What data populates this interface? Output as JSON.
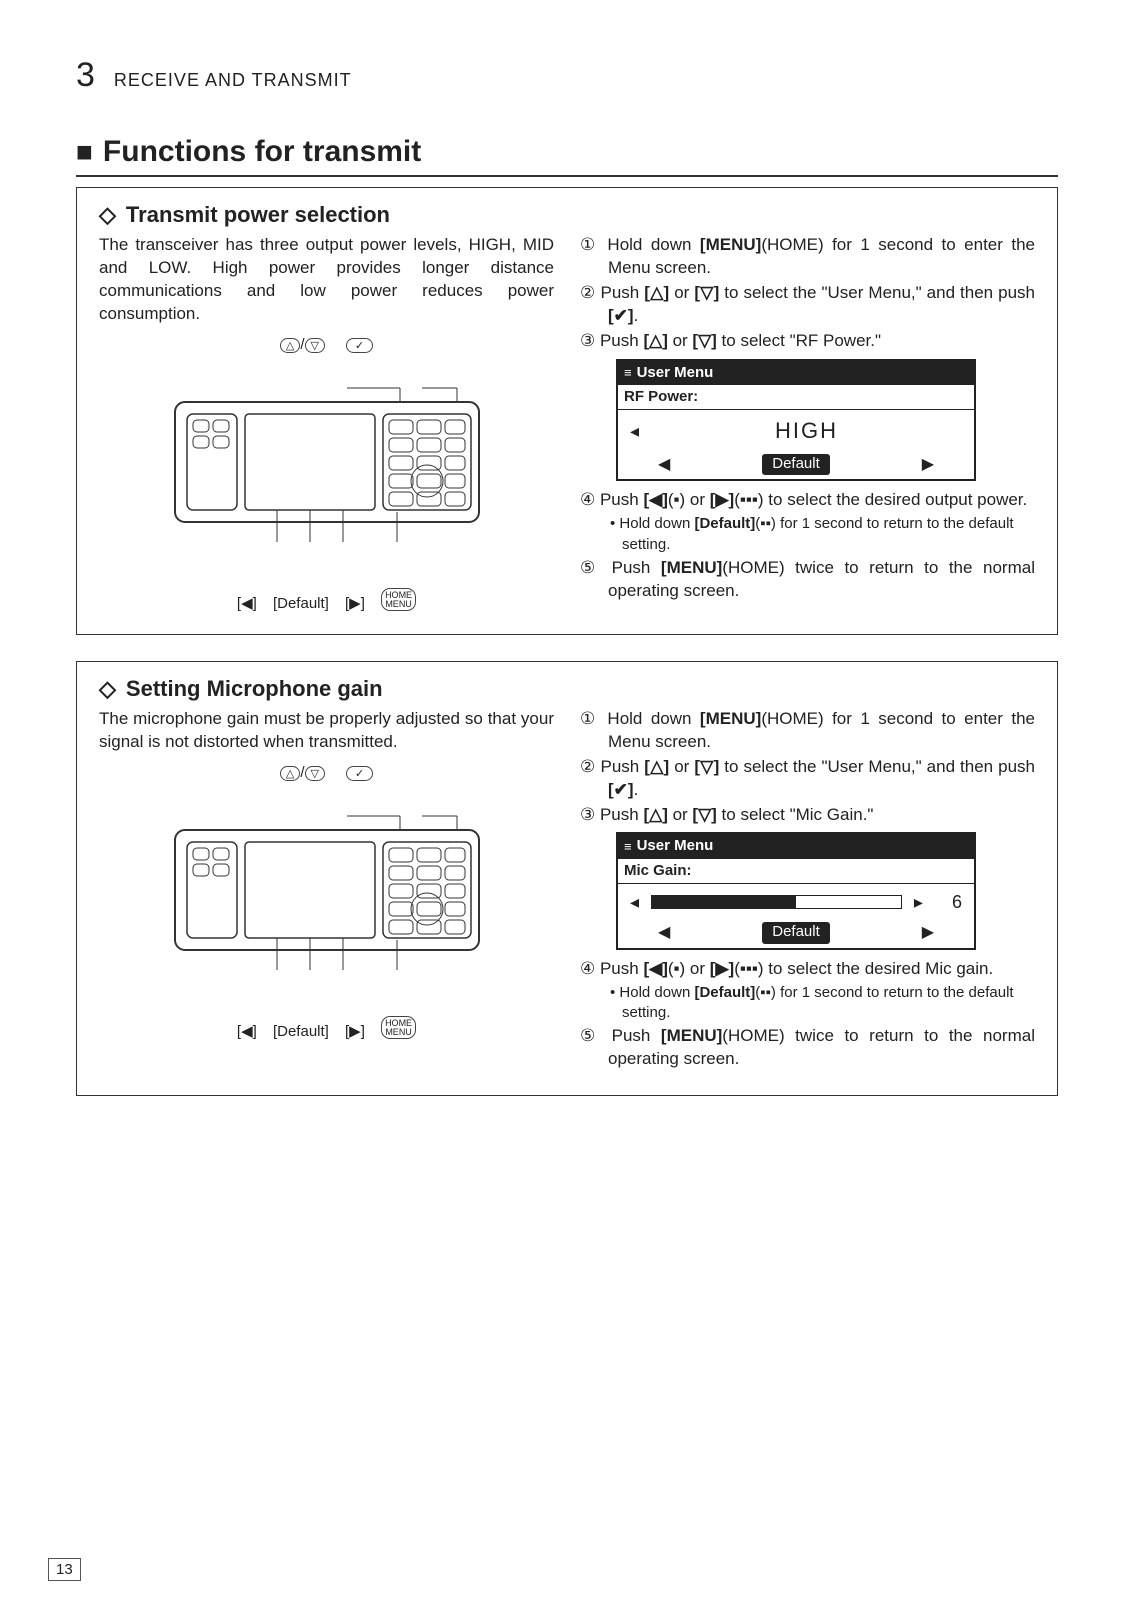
{
  "header": {
    "chapter_num": "3",
    "chapter_title": "RECEIVE AND TRANSMIT"
  },
  "main_title": "Functions for transmit",
  "section1": {
    "title": "Transmit power selection",
    "intro": "The transceiver has three output power levels, HIGH, MID and LOW. High power provides longer distance communications and low power reduces power consumption.",
    "top_callout_updn": "/",
    "bottom_callouts": {
      "left": "[◀]",
      "default": "[Default]",
      "right": "[▶]"
    },
    "steps": {
      "s1a": "Hold down ",
      "s1b": "[MENU]",
      "s1c": "(HOME) for 1 second to enter the Menu screen.",
      "s2a": "Push ",
      "s2b": "[△]",
      "s2c": " or ",
      "s2d": "[▽]",
      "s2e": " to select the \"User Menu,\" and then push ",
      "s2f": "[✔]",
      "s2g": ".",
      "s3a": "Push ",
      "s3b": "[△]",
      "s3c": " or ",
      "s3d": "[▽]",
      "s3e": " to select \"RF Power.\"",
      "s4a": "Push ",
      "s4b": "[◀]",
      "s4c": "(▪) or ",
      "s4d": "[▶]",
      "s4e": "(▪▪▪) to select the desired output power.",
      "note_a": "• Hold down ",
      "note_b": "[Default]",
      "note_c": "(▪▪) for 1 second to return to the default setting.",
      "s5a": "Push ",
      "s5b": "[MENU]",
      "s5c": "(HOME) twice to return to the normal operating screen."
    },
    "lcd": {
      "header": "User Menu",
      "sub": "RF Power:",
      "value": "HIGH",
      "default": "Default"
    }
  },
  "section2": {
    "title": "Setting Microphone gain",
    "intro": "The microphone gain must be properly adjusted so that your signal is not distorted when transmitted.",
    "bottom_callouts": {
      "left": "[◀]",
      "default": "[Default]",
      "right": "[▶]"
    },
    "steps": {
      "s1a": "Hold down ",
      "s1b": "[MENU]",
      "s1c": "(HOME) for 1 second to enter the Menu screen.",
      "s2a": "Push ",
      "s2b": "[△]",
      "s2c": " or ",
      "s2d": "[▽]",
      "s2e": " to select the \"User Menu,\" and then push ",
      "s2f": "[✔]",
      "s2g": ".",
      "s3a": "Push ",
      "s3b": "[△]",
      "s3c": " or ",
      "s3d": "[▽]",
      "s3e": " to select \"Mic Gain.\"",
      "s4a": "Push ",
      "s4b": "[◀]",
      "s4c": "(▪) or ",
      "s4d": "[▶]",
      "s4e": "(▪▪▪) to select the desired Mic gain.",
      "note_a": "• Hold down ",
      "note_b": "[Default]",
      "note_c": "(▪▪) for 1 second to return to the default setting.",
      "s5a": "Push ",
      "s5b": "[MENU]",
      "s5c": "(HOME) twice to return to the normal operating screen."
    },
    "lcd": {
      "header": "User Menu",
      "sub": "Mic Gain:",
      "value": "6",
      "default": "Default"
    }
  },
  "page_number": "13"
}
